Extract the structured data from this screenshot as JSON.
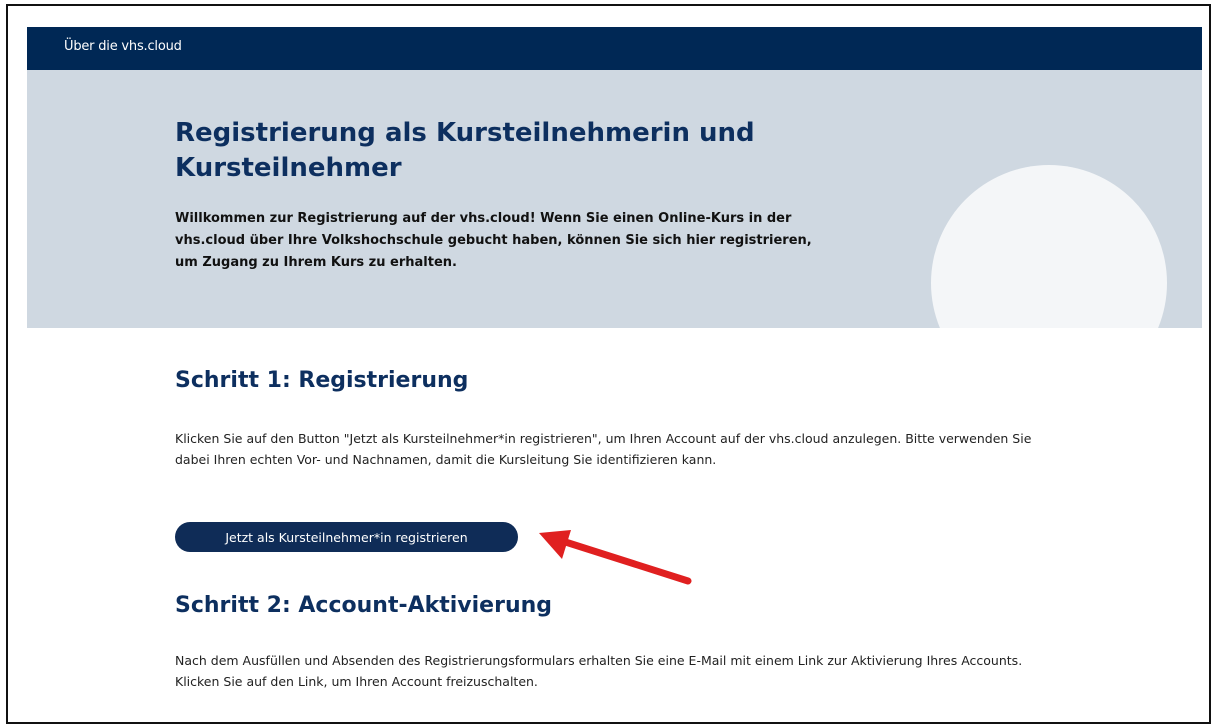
{
  "nav": {
    "about_link": "Über die vhs.cloud"
  },
  "hero": {
    "title": "Registrierung als Kursteilnehmerin und Kursteilnehmer",
    "intro": "Willkommen zur Registrierung auf der vhs.cloud! Wenn Sie einen Online-Kurs in der vhs.cloud über Ihre Volkshochschule gebucht haben, können Sie sich hier registrieren, um Zugang zu Ihrem Kurs zu erhalten."
  },
  "steps": [
    {
      "title": "Schritt 1: Registrierung",
      "text": "Klicken Sie auf den Button \"Jetzt als Kursteilnehmer*in registrieren\", um Ihren Account auf der vhs.cloud anzulegen. Bitte verwenden Sie dabei Ihren echten Vor- und Nachnamen, damit die Kursleitung Sie identifizieren kann.",
      "button_label": "Jetzt als Kursteilnehmer*in registrieren"
    },
    {
      "title": "Schritt 2: Account-Aktivierung",
      "text": "Nach dem Ausfüllen und Absenden des Registrierungsformulars erhalten Sie eine E-Mail mit einem Link zur Aktivierung Ihres Accounts. Klicken Sie auf den Link, um Ihren Account freizuschalten."
    }
  ],
  "colors": {
    "nav_background": "#002855",
    "hero_background": "#cfd8e1",
    "heading": "#0d2f5f",
    "button_background": "#0f2c57",
    "annotation_arrow": "#e02020"
  },
  "icons": {
    "annotation": "red-arrow-icon"
  }
}
